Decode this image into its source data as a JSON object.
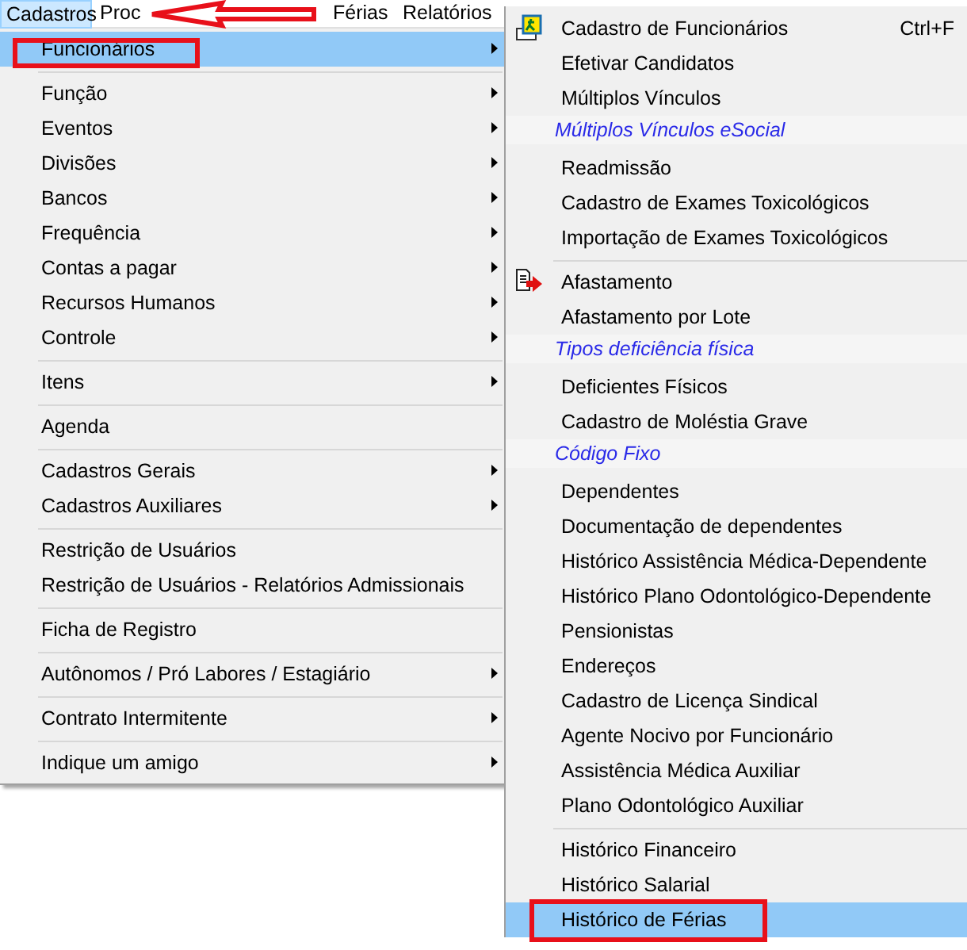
{
  "menu_bar": [
    {
      "label": "Cadastros",
      "selected": true
    },
    {
      "label": "Proc",
      "selected": false
    },
    {
      "label": "Férias",
      "selected": false
    },
    {
      "label": "Relatórios",
      "selected": false
    }
  ],
  "menu": [
    {
      "kind": "item",
      "label": "Funcionários",
      "submenu": true,
      "selected": true
    },
    {
      "kind": "separator"
    },
    {
      "kind": "item",
      "label": "Função",
      "submenu": true,
      "selected": false
    },
    {
      "kind": "item",
      "label": "Eventos",
      "submenu": true,
      "selected": false
    },
    {
      "kind": "item",
      "label": "Divisões",
      "submenu": true,
      "selected": false
    },
    {
      "kind": "item",
      "label": "Bancos",
      "submenu": true,
      "selected": false
    },
    {
      "kind": "item",
      "label": "Frequência",
      "submenu": true,
      "selected": false
    },
    {
      "kind": "item",
      "label": "Contas a pagar",
      "submenu": true,
      "selected": false
    },
    {
      "kind": "item",
      "label": "Recursos Humanos",
      "submenu": true,
      "selected": false
    },
    {
      "kind": "item",
      "label": "Controle",
      "submenu": true,
      "selected": false
    },
    {
      "kind": "separator"
    },
    {
      "kind": "item",
      "label": "Itens",
      "submenu": true,
      "selected": false
    },
    {
      "kind": "separator"
    },
    {
      "kind": "item",
      "label": "Agenda",
      "submenu": false,
      "selected": false
    },
    {
      "kind": "separator"
    },
    {
      "kind": "item",
      "label": "Cadastros Gerais",
      "submenu": true,
      "selected": false
    },
    {
      "kind": "item",
      "label": "Cadastros Auxiliares",
      "submenu": true,
      "selected": false
    },
    {
      "kind": "separator"
    },
    {
      "kind": "item",
      "label": "Restrição de Usuários",
      "submenu": false,
      "selected": false
    },
    {
      "kind": "item",
      "label": "Restrição de Usuários - Relatórios Admissionais",
      "submenu": false,
      "selected": false
    },
    {
      "kind": "separator"
    },
    {
      "kind": "item",
      "label": "Ficha de Registro",
      "submenu": false,
      "selected": false
    },
    {
      "kind": "separator"
    },
    {
      "kind": "item",
      "label": "Autônomos / Pró Labores / Estagiário",
      "submenu": true,
      "selected": false
    },
    {
      "kind": "separator"
    },
    {
      "kind": "item",
      "label": "Contrato Intermitente",
      "submenu": true,
      "selected": false
    },
    {
      "kind": "separator"
    },
    {
      "kind": "item",
      "label": "Indique um amigo",
      "submenu": true,
      "selected": false
    }
  ],
  "submenu": [
    {
      "kind": "item",
      "label": "Cadastro de Funcionários",
      "shortcut": "Ctrl+F",
      "selected": false
    },
    {
      "kind": "item",
      "label": "Efetivar Candidatos",
      "selected": false
    },
    {
      "kind": "item",
      "label": "Múltiplos Vínculos",
      "selected": false
    },
    {
      "kind": "header",
      "label": "Múltiplos Vínculos eSocial"
    },
    {
      "kind": "item",
      "label": "Readmissão",
      "selected": false
    },
    {
      "kind": "item",
      "label": "Cadastro de Exames Toxicológicos",
      "selected": false
    },
    {
      "kind": "item",
      "label": "Importação de Exames Toxicológicos",
      "selected": false
    },
    {
      "kind": "separator"
    },
    {
      "kind": "item",
      "label": "Afastamento",
      "selected": false
    },
    {
      "kind": "item",
      "label": "Afastamento por Lote",
      "selected": false
    },
    {
      "kind": "header",
      "label": "Tipos deficiência física"
    },
    {
      "kind": "item",
      "label": "Deficientes Físicos",
      "selected": false
    },
    {
      "kind": "item",
      "label": "Cadastro de Moléstia Grave",
      "selected": false
    },
    {
      "kind": "header",
      "label": "Código Fixo"
    },
    {
      "kind": "item",
      "label": "Dependentes",
      "selected": false
    },
    {
      "kind": "item",
      "label": "Documentação de dependentes",
      "selected": false
    },
    {
      "kind": "item",
      "label": "Histórico Assistência Médica-Dependente",
      "selected": false
    },
    {
      "kind": "item",
      "label": "Histórico Plano Odontológico-Dependente",
      "selected": false
    },
    {
      "kind": "item",
      "label": "Pensionistas",
      "selected": false
    },
    {
      "kind": "item",
      "label": "Endereços",
      "selected": false
    },
    {
      "kind": "item",
      "label": "Cadastro de Licença Sindical",
      "selected": false
    },
    {
      "kind": "item",
      "label": "Agente Nocivo por Funcionário",
      "selected": false
    },
    {
      "kind": "item",
      "label": "Assistência Médica Auxiliar",
      "selected": false
    },
    {
      "kind": "item",
      "label": "Plano Odontológico Auxiliar",
      "selected": false
    },
    {
      "kind": "separator"
    },
    {
      "kind": "item",
      "label": "Histórico Financeiro",
      "selected": false
    },
    {
      "kind": "item",
      "label": "Histórico Salarial",
      "selected": false
    },
    {
      "kind": "item",
      "label": "Histórico de Férias",
      "selected": true
    }
  ]
}
